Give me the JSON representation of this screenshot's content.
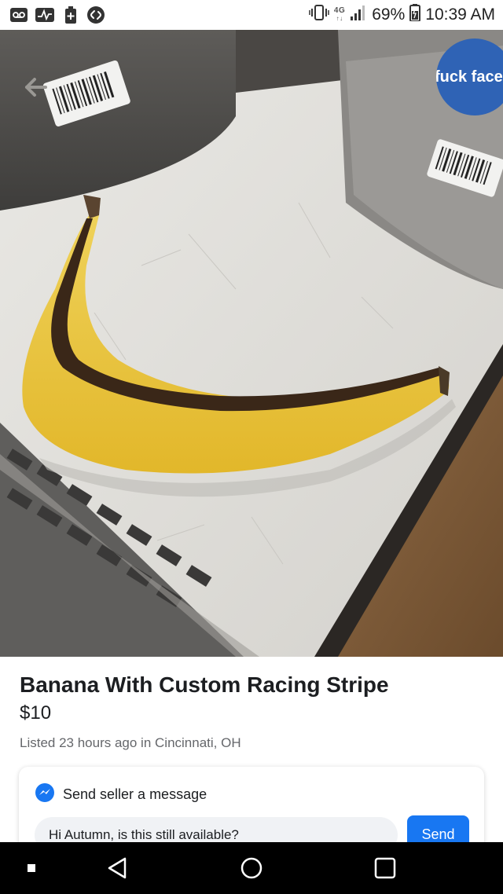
{
  "status_bar": {
    "network_type": "4G",
    "battery_percent": "69%",
    "time": "10:39 AM",
    "left_icons": [
      "voicemail-icon",
      "activity-icon",
      "battery-saver-icon",
      "shazam-icon"
    ],
    "right_icons": [
      "vibrate-icon",
      "lte-icon",
      "signal-icon",
      "battery-icon"
    ]
  },
  "header": {
    "back_icon": "back-arrow-icon",
    "profile_badge_text": "fuck facel",
    "profile_badge_color": "#2f63b5"
  },
  "listing": {
    "title": "Banana With Custom Racing Stripe",
    "price": "$10",
    "meta": "Listed 23 hours ago in Cincinnati, OH"
  },
  "message_card": {
    "heading": "Send seller a message",
    "icon": "messenger-icon",
    "input_value": "Hi Autumn, is this still available?",
    "send_label": "Send",
    "send_color": "#1877f2"
  },
  "nav_bar": {
    "buttons": [
      "recents-dot-icon",
      "back-triangle-icon",
      "home-circle-icon",
      "overview-square-icon"
    ]
  }
}
